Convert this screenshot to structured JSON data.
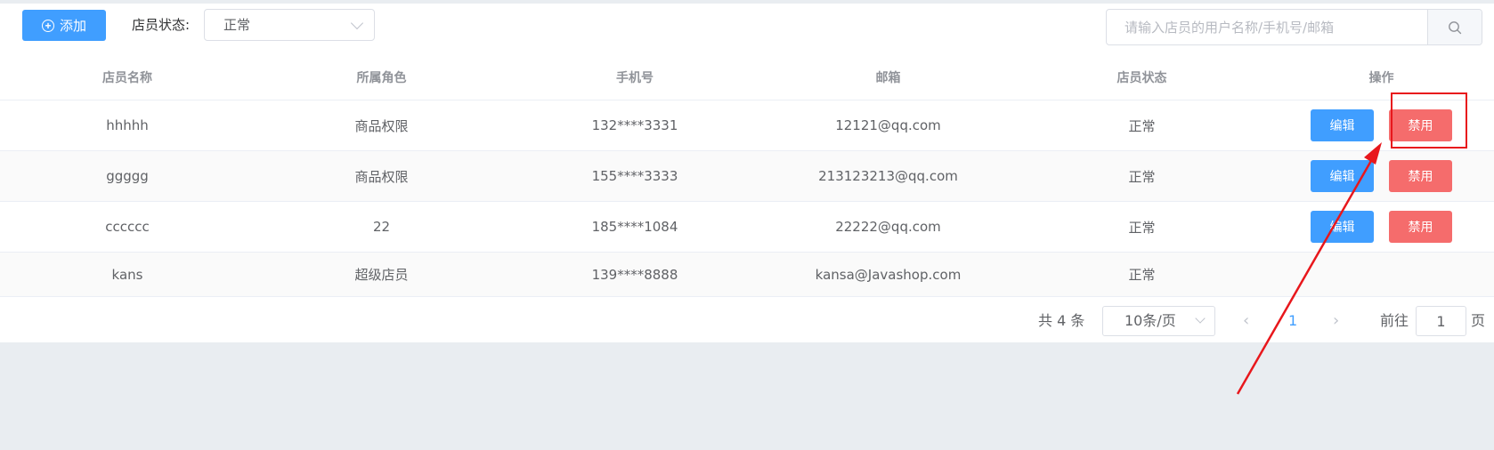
{
  "toolbar": {
    "add_label": "添加",
    "status_label": "店员状态:",
    "status_value": "正常",
    "search_placeholder": "请输入店员的用户名称/手机号/邮箱"
  },
  "table": {
    "headers": [
      "店员名称",
      "所属角色",
      "手机号",
      "邮箱",
      "店员状态",
      "操作"
    ],
    "rows": [
      {
        "name": "hhhhh",
        "role": "商品权限",
        "phone": "132****3331",
        "email": "12121@qq.com",
        "status": "正常",
        "edit": "编辑",
        "disable": "禁用"
      },
      {
        "name": "ggggg",
        "role": "商品权限",
        "phone": "155****3333",
        "email": "213123213@qq.com",
        "status": "正常",
        "edit": "编辑",
        "disable": "禁用"
      },
      {
        "name": "cccccc",
        "role": "22",
        "phone": "185****1084",
        "email": "22222@qq.com",
        "status": "正常",
        "edit": "编辑",
        "disable": "禁用"
      },
      {
        "name": "kans",
        "role": "超级店员",
        "phone": "139****8888",
        "email": "kansa@Javashop.com",
        "status": "正常"
      }
    ]
  },
  "pagination": {
    "total_text": "共 4 条",
    "page_size": "10条/页",
    "prev": "‹",
    "current_page": "1",
    "next": "›",
    "goto_label": "前往",
    "goto_value": "1",
    "goto_suffix": "页"
  },
  "colors": {
    "primary": "#409eff",
    "danger": "#f56c6c",
    "annotation": "#e8171c"
  }
}
